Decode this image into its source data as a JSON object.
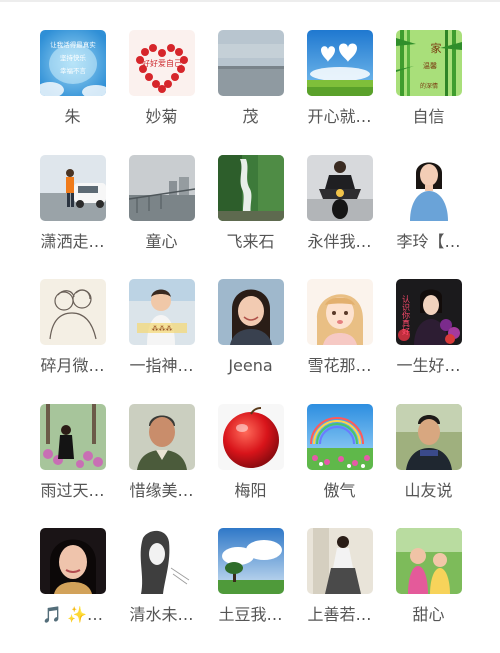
{
  "contacts": [
    {
      "name": "朱",
      "avatar": "sky-hearts-text",
      "avatar_text": [
        "让我活得最真实",
        "坚持快乐",
        "幸福不言"
      ]
    },
    {
      "name": "妙菊",
      "avatar": "rose-heart",
      "avatar_text": [
        "好好爱自己"
      ]
    },
    {
      "name": "茂",
      "avatar": "lake-grey-sky"
    },
    {
      "name": "开心就…",
      "avatar": "cloud-hearts-meadow"
    },
    {
      "name": "自信",
      "avatar": "bamboo-calligraphy",
      "avatar_text": [
        "家",
        "温馨",
        "的深情"
      ]
    },
    {
      "name": "潇洒走…",
      "avatar": "woman-by-car"
    },
    {
      "name": "童心",
      "avatar": "river-railing"
    },
    {
      "name": "飞来石",
      "avatar": "waterfall-cliff"
    },
    {
      "name": "永伴我…",
      "avatar": "motorcycle-rider"
    },
    {
      "name": "李玲【…",
      "avatar": "woman-blue-top"
    },
    {
      "name": "碎月微…",
      "avatar": "sketch-couple"
    },
    {
      "name": "一指神…",
      "avatar": "child-photo"
    },
    {
      "name": "Jeena",
      "avatar": "smiling-woman"
    },
    {
      "name": "雪花那…",
      "avatar": "blonde-cartoon-girl"
    },
    {
      "name": "一生好…",
      "avatar": "woman-roses",
      "avatar_text": [
        "认识你真好"
      ]
    },
    {
      "name": "雨过天…",
      "avatar": "woman-flowers"
    },
    {
      "name": "惜缘美…",
      "avatar": "older-man"
    },
    {
      "name": "梅阳",
      "avatar": "red-apple"
    },
    {
      "name": "傲气",
      "avatar": "rainbow-flower-field"
    },
    {
      "name": "山友说",
      "avatar": "man-outdoors"
    },
    {
      "name": "🎵 ✨…",
      "avatar": "woman-closeup"
    },
    {
      "name": "清水未…",
      "avatar": "sketch-woman"
    },
    {
      "name": "土豆我…",
      "avatar": "tree-cloudy-sky"
    },
    {
      "name": "上善若…",
      "avatar": "woman-dress"
    },
    {
      "name": "甜心",
      "avatar": "two-children-garden"
    }
  ],
  "colors": {
    "background": "#ffffff",
    "name_text": "#555555",
    "divider": "#ededed"
  }
}
